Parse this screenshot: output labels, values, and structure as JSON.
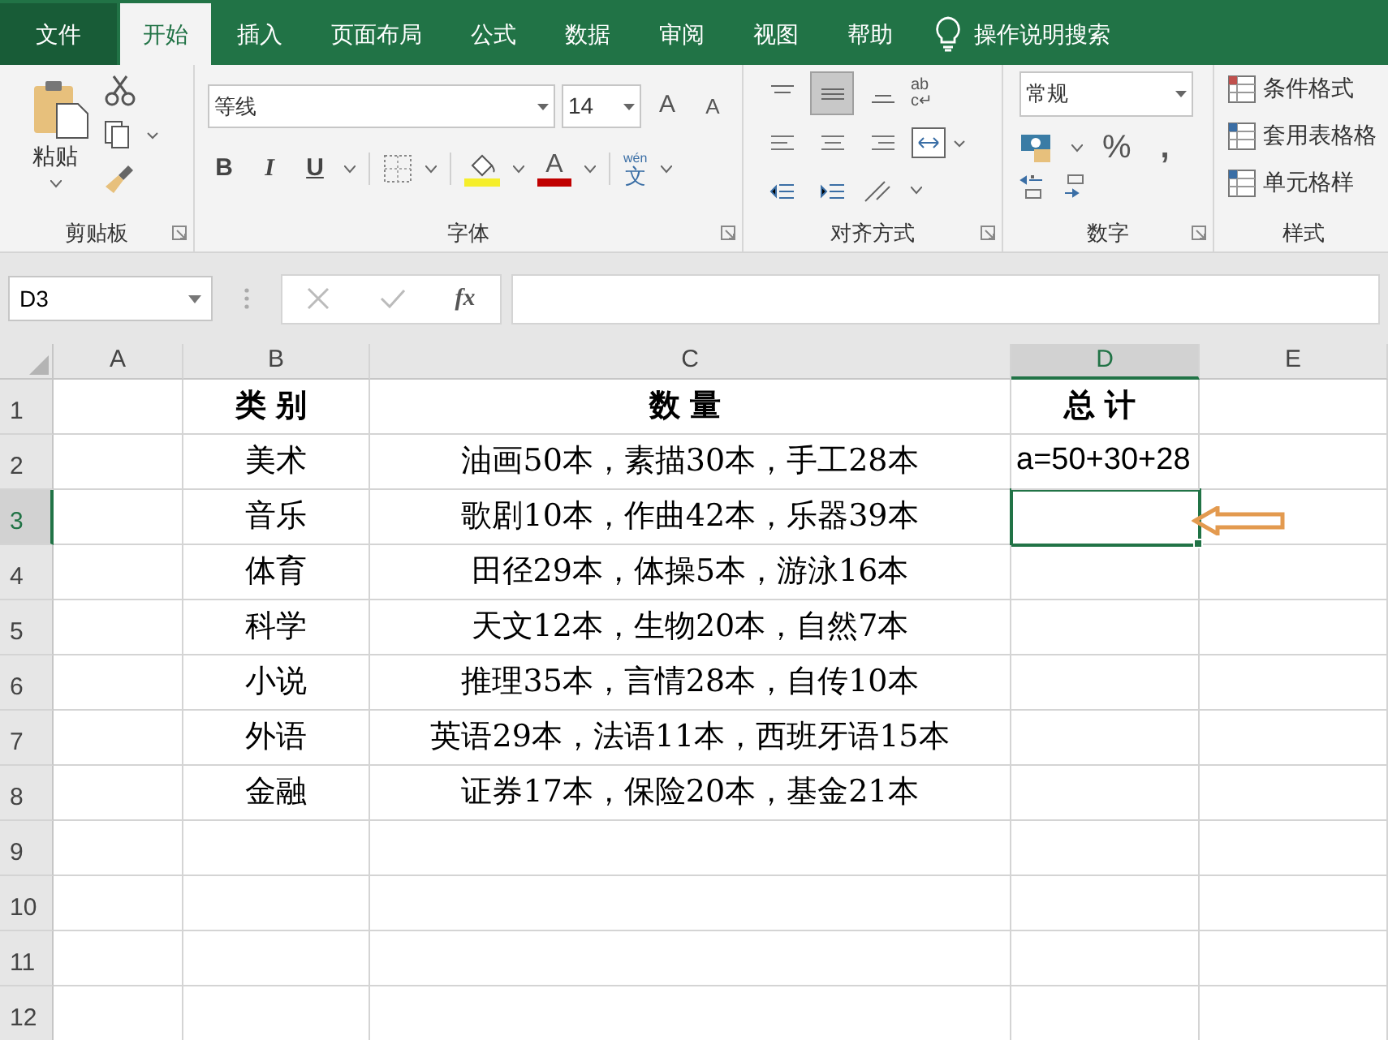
{
  "tabs": [
    {
      "label": "文件",
      "selected": false
    },
    {
      "label": "开始",
      "selected": true
    },
    {
      "label": "插入",
      "selected": false
    },
    {
      "label": "页面布局",
      "selected": false
    },
    {
      "label": "公式",
      "selected": false
    },
    {
      "label": "数据",
      "selected": false
    },
    {
      "label": "审阅",
      "selected": false
    },
    {
      "label": "视图",
      "selected": false
    },
    {
      "label": "帮助",
      "selected": false
    }
  ],
  "tell_me": "操作说明搜索",
  "ribbon": {
    "clipboard": {
      "paste": "粘贴",
      "group": "剪贴板"
    },
    "font": {
      "name": "等线",
      "size": "14",
      "grow": "A",
      "shrink": "A",
      "bold": "B",
      "italic": "I",
      "underline": "U",
      "font_color": "A",
      "phonetic_top": "wén",
      "phonetic_bottom": "文",
      "group": "字体"
    },
    "alignment": {
      "wrap_top": "ab",
      "wrap_bottom": "c↵",
      "group": "对齐方式"
    },
    "number": {
      "format": "常规",
      "percent": "%",
      "comma": ",",
      "group": "数字"
    },
    "styles": {
      "items": [
        "条件格式",
        "套用表格格",
        "单元格样"
      ],
      "group": "样式"
    }
  },
  "formula_bar": {
    "name_box": "D3",
    "fx": "fx"
  },
  "columns": [
    {
      "label": "A",
      "selected": false
    },
    {
      "label": "B",
      "selected": false
    },
    {
      "label": "C",
      "selected": false
    },
    {
      "label": "D",
      "selected": true
    },
    {
      "label": "E",
      "selected": false
    }
  ],
  "rows": [
    {
      "number": "1",
      "selected": false,
      "cells": [
        "",
        "类别",
        "数量",
        "总计",
        ""
      ]
    },
    {
      "number": "2",
      "selected": false,
      "cells": [
        "",
        "美术",
        "油画50本，素描30本，手工28本",
        "a=50+30+28",
        ""
      ]
    },
    {
      "number": "3",
      "selected": true,
      "cells": [
        "",
        "音乐",
        "歌剧10本，作曲42本，乐器39本",
        "",
        ""
      ]
    },
    {
      "number": "4",
      "selected": false,
      "cells": [
        "",
        "体育",
        "田径29本，体操5本，游泳16本",
        "",
        ""
      ]
    },
    {
      "number": "5",
      "selected": false,
      "cells": [
        "",
        "科学",
        "天文12本，生物20本，自然7本",
        "",
        ""
      ]
    },
    {
      "number": "6",
      "selected": false,
      "cells": [
        "",
        "小说",
        "推理35本，言情28本，自传10本",
        "",
        ""
      ]
    },
    {
      "number": "7",
      "selected": false,
      "cells": [
        "",
        "外语",
        "英语29本，法语11本，西班牙语15本",
        "",
        ""
      ]
    },
    {
      "number": "8",
      "selected": false,
      "cells": [
        "",
        "金融",
        "证券17本，保险20本，基金21本",
        "",
        ""
      ]
    },
    {
      "number": "9",
      "selected": false,
      "cells": [
        "",
        "",
        "",
        "",
        ""
      ]
    },
    {
      "number": "10",
      "selected": false,
      "cells": [
        "",
        "",
        "",
        "",
        ""
      ]
    },
    {
      "number": "11",
      "selected": false,
      "cells": [
        "",
        "",
        "",
        "",
        ""
      ]
    },
    {
      "number": "12",
      "selected": false,
      "cells": [
        "",
        "",
        "",
        "",
        ""
      ]
    }
  ]
}
